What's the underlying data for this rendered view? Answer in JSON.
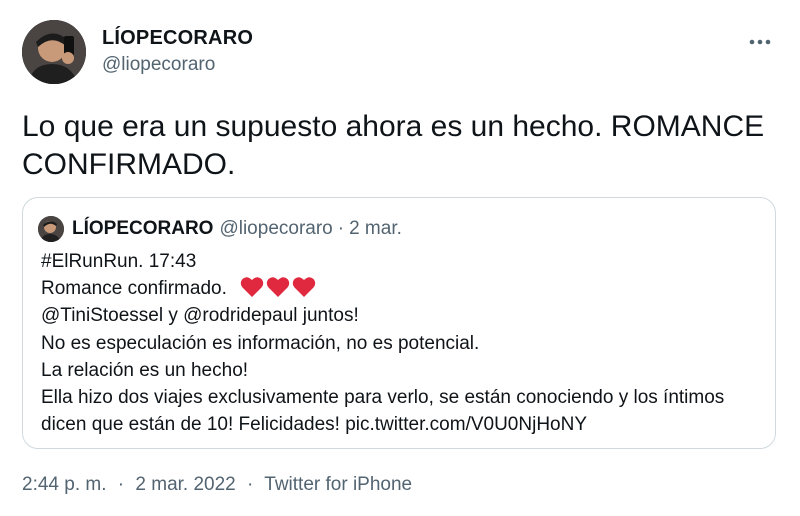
{
  "author": {
    "display_name": "LÍOPECORARO",
    "handle": "@liopecoraro",
    "avatar_icon": "profile-photo"
  },
  "more_icon": "ellipsis-horizontal-icon",
  "tweet": {
    "text": "Lo que era un supuesto ahora es un hecho. ROMANCE CONFIRMADO."
  },
  "quote": {
    "display_name": "LÍOPECORARO",
    "handle": "@liopecoraro",
    "separator": "·",
    "date": "2 mar.",
    "lines": [
      "#ElRunRun. 17:43",
      "Romance confirmado.",
      "@TiniStoessel y @rodridepaul juntos!",
      "No es especulación es información, no es potencial.",
      "La relación es un hecho!",
      "Ella hizo dos viajes exclusivamente para verlo, se están conociendo y los íntimos",
      "dicen que están de 10! Felicidades! pic.twitter.com/V0U0NjHoNY"
    ],
    "heart_emoji_count": 3,
    "heart_color": "#e0283e"
  },
  "meta": {
    "time": "2:44 p. m.",
    "separator": "·",
    "date": "2 mar. 2022",
    "source": "Twitter for iPhone"
  },
  "colors": {
    "text_primary": "#0f1419",
    "text_secondary": "#536471",
    "border": "#cfd9de"
  }
}
